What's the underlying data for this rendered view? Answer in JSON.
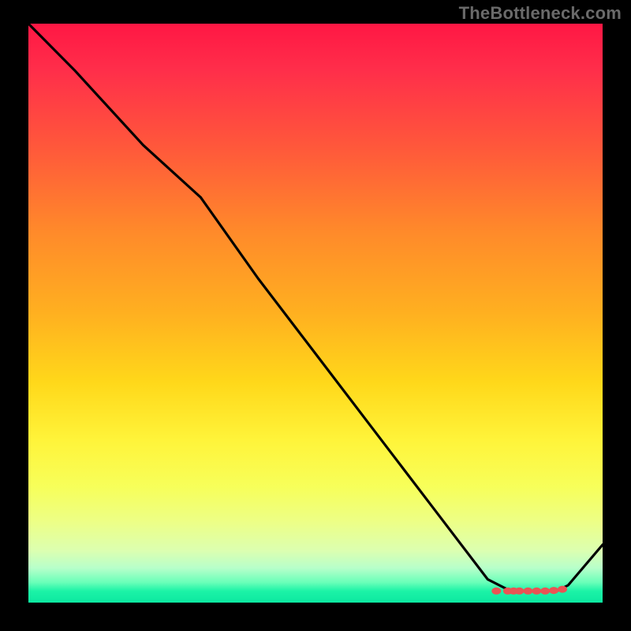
{
  "watermark": "TheBottleneck.com",
  "chart_data": {
    "type": "line",
    "title": "",
    "xlabel": "",
    "ylabel": "",
    "xlim": [
      0,
      100
    ],
    "ylim": [
      0,
      100
    ],
    "grid": false,
    "legend": false,
    "series": [
      {
        "name": "bottleneck-curve",
        "x": [
          0,
          8,
          20,
          30,
          40,
          50,
          60,
          70,
          80,
          84,
          88,
          92,
          94,
          100
        ],
        "values": [
          100,
          92,
          79,
          70,
          56,
          43,
          30,
          17,
          4,
          2,
          2,
          2,
          3,
          10
        ]
      }
    ],
    "markers": {
      "name": "optimal-range-markers",
      "x": [
        81.5,
        83.5,
        84.5,
        85.5,
        87.0,
        88.5,
        90.0,
        91.5,
        93.0
      ],
      "values": [
        2.0,
        2.0,
        2.0,
        2.0,
        2.0,
        2.0,
        2.0,
        2.1,
        2.3
      ]
    },
    "background_gradient": {
      "stops": [
        {
          "pos": 0,
          "color": "#ff1744"
        },
        {
          "pos": 50,
          "color": "#ffd81a"
        },
        {
          "pos": 80,
          "color": "#f7ff5a"
        },
        {
          "pos": 100,
          "color": "#0ce8a0"
        }
      ]
    }
  }
}
